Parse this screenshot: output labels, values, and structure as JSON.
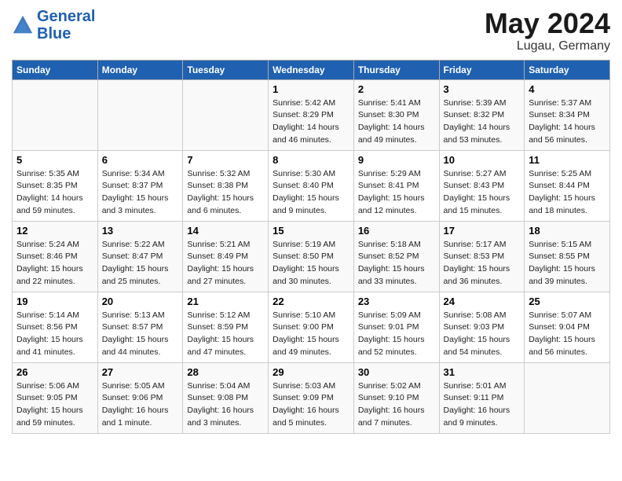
{
  "header": {
    "logo_line1": "General",
    "logo_line2": "Blue",
    "month_year": "May 2024",
    "location": "Lugau, Germany"
  },
  "days_of_week": [
    "Sunday",
    "Monday",
    "Tuesday",
    "Wednesday",
    "Thursday",
    "Friday",
    "Saturday"
  ],
  "weeks": [
    [
      {
        "day": "",
        "info": ""
      },
      {
        "day": "",
        "info": ""
      },
      {
        "day": "",
        "info": ""
      },
      {
        "day": "1",
        "info": "Sunrise: 5:42 AM\nSunset: 8:29 PM\nDaylight: 14 hours\nand 46 minutes."
      },
      {
        "day": "2",
        "info": "Sunrise: 5:41 AM\nSunset: 8:30 PM\nDaylight: 14 hours\nand 49 minutes."
      },
      {
        "day": "3",
        "info": "Sunrise: 5:39 AM\nSunset: 8:32 PM\nDaylight: 14 hours\nand 53 minutes."
      },
      {
        "day": "4",
        "info": "Sunrise: 5:37 AM\nSunset: 8:34 PM\nDaylight: 14 hours\nand 56 minutes."
      }
    ],
    [
      {
        "day": "5",
        "info": "Sunrise: 5:35 AM\nSunset: 8:35 PM\nDaylight: 14 hours\nand 59 minutes."
      },
      {
        "day": "6",
        "info": "Sunrise: 5:34 AM\nSunset: 8:37 PM\nDaylight: 15 hours\nand 3 minutes."
      },
      {
        "day": "7",
        "info": "Sunrise: 5:32 AM\nSunset: 8:38 PM\nDaylight: 15 hours\nand 6 minutes."
      },
      {
        "day": "8",
        "info": "Sunrise: 5:30 AM\nSunset: 8:40 PM\nDaylight: 15 hours\nand 9 minutes."
      },
      {
        "day": "9",
        "info": "Sunrise: 5:29 AM\nSunset: 8:41 PM\nDaylight: 15 hours\nand 12 minutes."
      },
      {
        "day": "10",
        "info": "Sunrise: 5:27 AM\nSunset: 8:43 PM\nDaylight: 15 hours\nand 15 minutes."
      },
      {
        "day": "11",
        "info": "Sunrise: 5:25 AM\nSunset: 8:44 PM\nDaylight: 15 hours\nand 18 minutes."
      }
    ],
    [
      {
        "day": "12",
        "info": "Sunrise: 5:24 AM\nSunset: 8:46 PM\nDaylight: 15 hours\nand 22 minutes."
      },
      {
        "day": "13",
        "info": "Sunrise: 5:22 AM\nSunset: 8:47 PM\nDaylight: 15 hours\nand 25 minutes."
      },
      {
        "day": "14",
        "info": "Sunrise: 5:21 AM\nSunset: 8:49 PM\nDaylight: 15 hours\nand 27 minutes."
      },
      {
        "day": "15",
        "info": "Sunrise: 5:19 AM\nSunset: 8:50 PM\nDaylight: 15 hours\nand 30 minutes."
      },
      {
        "day": "16",
        "info": "Sunrise: 5:18 AM\nSunset: 8:52 PM\nDaylight: 15 hours\nand 33 minutes."
      },
      {
        "day": "17",
        "info": "Sunrise: 5:17 AM\nSunset: 8:53 PM\nDaylight: 15 hours\nand 36 minutes."
      },
      {
        "day": "18",
        "info": "Sunrise: 5:15 AM\nSunset: 8:55 PM\nDaylight: 15 hours\nand 39 minutes."
      }
    ],
    [
      {
        "day": "19",
        "info": "Sunrise: 5:14 AM\nSunset: 8:56 PM\nDaylight: 15 hours\nand 41 minutes."
      },
      {
        "day": "20",
        "info": "Sunrise: 5:13 AM\nSunset: 8:57 PM\nDaylight: 15 hours\nand 44 minutes."
      },
      {
        "day": "21",
        "info": "Sunrise: 5:12 AM\nSunset: 8:59 PM\nDaylight: 15 hours\nand 47 minutes."
      },
      {
        "day": "22",
        "info": "Sunrise: 5:10 AM\nSunset: 9:00 PM\nDaylight: 15 hours\nand 49 minutes."
      },
      {
        "day": "23",
        "info": "Sunrise: 5:09 AM\nSunset: 9:01 PM\nDaylight: 15 hours\nand 52 minutes."
      },
      {
        "day": "24",
        "info": "Sunrise: 5:08 AM\nSunset: 9:03 PM\nDaylight: 15 hours\nand 54 minutes."
      },
      {
        "day": "25",
        "info": "Sunrise: 5:07 AM\nSunset: 9:04 PM\nDaylight: 15 hours\nand 56 minutes."
      }
    ],
    [
      {
        "day": "26",
        "info": "Sunrise: 5:06 AM\nSunset: 9:05 PM\nDaylight: 15 hours\nand 59 minutes."
      },
      {
        "day": "27",
        "info": "Sunrise: 5:05 AM\nSunset: 9:06 PM\nDaylight: 16 hours\nand 1 minute."
      },
      {
        "day": "28",
        "info": "Sunrise: 5:04 AM\nSunset: 9:08 PM\nDaylight: 16 hours\nand 3 minutes."
      },
      {
        "day": "29",
        "info": "Sunrise: 5:03 AM\nSunset: 9:09 PM\nDaylight: 16 hours\nand 5 minutes."
      },
      {
        "day": "30",
        "info": "Sunrise: 5:02 AM\nSunset: 9:10 PM\nDaylight: 16 hours\nand 7 minutes."
      },
      {
        "day": "31",
        "info": "Sunrise: 5:01 AM\nSunset: 9:11 PM\nDaylight: 16 hours\nand 9 minutes."
      },
      {
        "day": "",
        "info": ""
      }
    ]
  ]
}
